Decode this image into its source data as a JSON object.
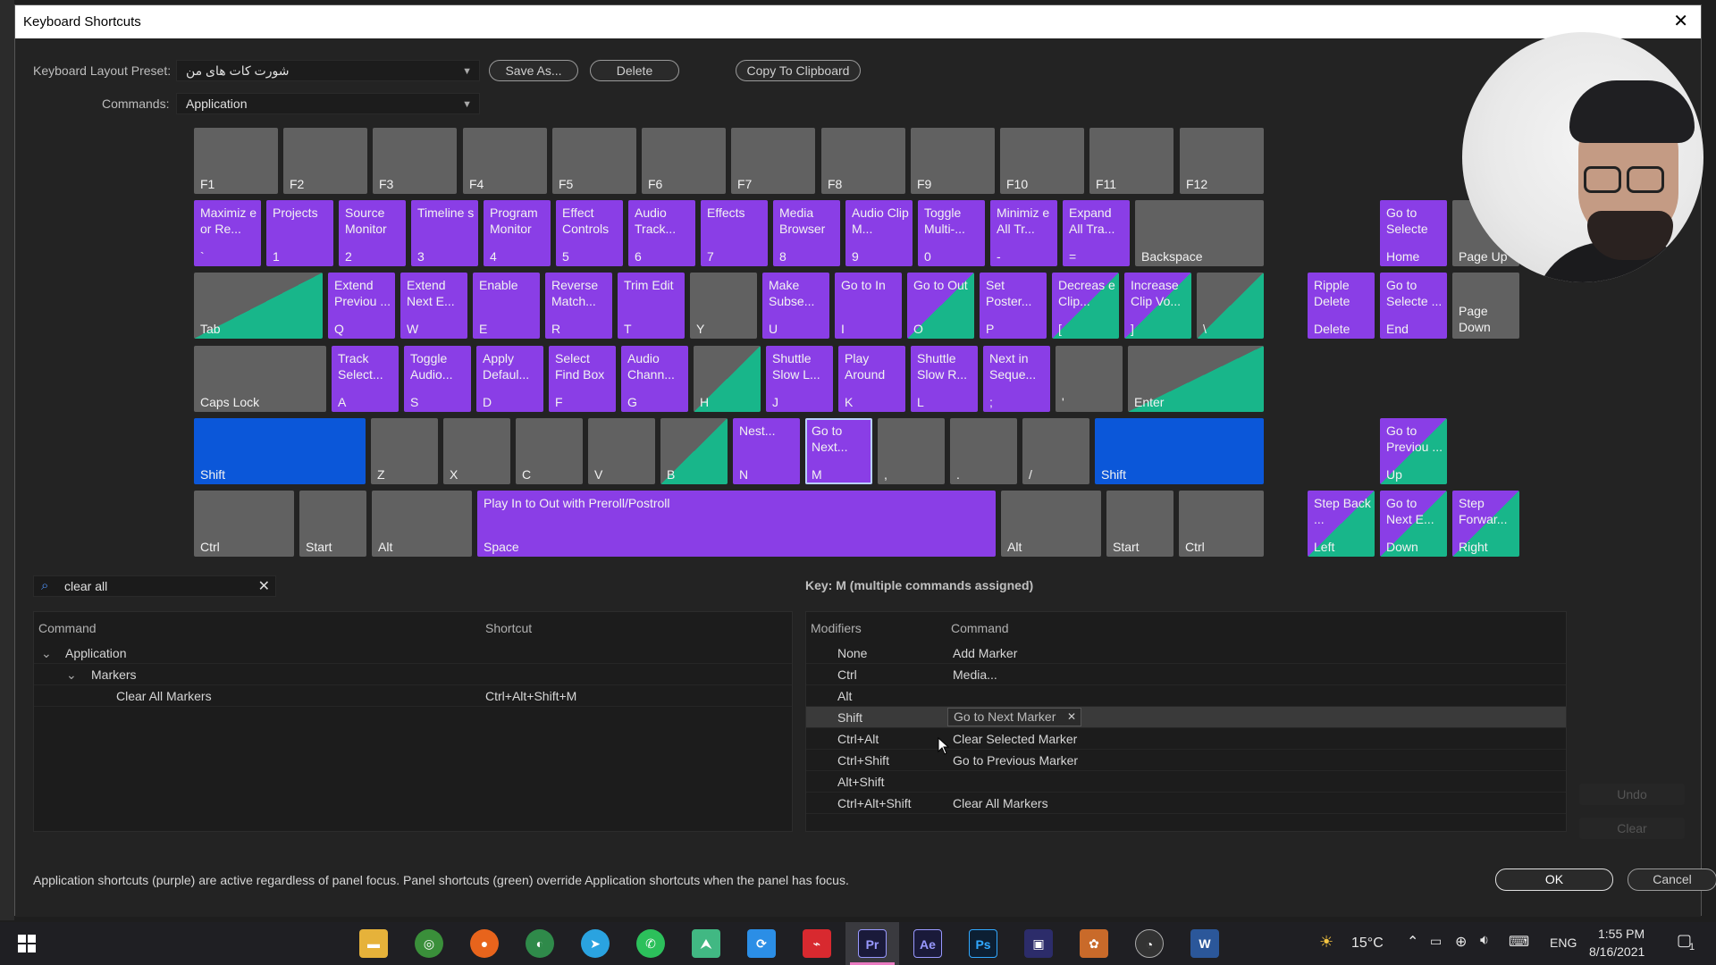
{
  "window": {
    "title": "Keyboard Shortcuts",
    "close": "✕"
  },
  "toolbar": {
    "layout_label": "Keyboard Layout Preset:",
    "layout_value": "شورت کات های من",
    "commands_label": "Commands:",
    "commands_value": "Application",
    "save_as": "Save As...",
    "delete": "Delete",
    "copy": "Copy To Clipboard"
  },
  "keys": {
    "f1": {
      "label": "F1"
    },
    "f2": {
      "label": "F2"
    },
    "f3": {
      "label": "F3"
    },
    "f4": {
      "label": "F4"
    },
    "f5": {
      "label": "F5"
    },
    "f6": {
      "label": "F6"
    },
    "f7": {
      "label": "F7"
    },
    "f8": {
      "label": "F8"
    },
    "f9": {
      "label": "F9"
    },
    "f10": {
      "label": "F10"
    },
    "f11": {
      "label": "F11"
    },
    "f12": {
      "label": "F12"
    },
    "grave": {
      "cmd": "Maximiz e or Re...",
      "label": "`"
    },
    "k1": {
      "cmd": "Projects",
      "label": "1"
    },
    "k2": {
      "cmd": "Source Monitor",
      "label": "2"
    },
    "k3": {
      "cmd": "Timeline s",
      "label": "3"
    },
    "k4": {
      "cmd": "Program Monitor",
      "label": "4"
    },
    "k5": {
      "cmd": "Effect Controls",
      "label": "5"
    },
    "k6": {
      "cmd": "Audio Track...",
      "label": "6"
    },
    "k7": {
      "cmd": "Effects",
      "label": "7"
    },
    "k8": {
      "cmd": "Media Browser",
      "label": "8"
    },
    "k9": {
      "cmd": "Audio Clip M...",
      "label": "9"
    },
    "k0": {
      "cmd": "Toggle Multi-...",
      "label": "0"
    },
    "minus": {
      "cmd": "Minimiz e All Tr...",
      "label": "-"
    },
    "equals": {
      "cmd": "Expand All Tra...",
      "label": "="
    },
    "backspace": {
      "label": "Backspace"
    },
    "tab": {
      "label": "Tab"
    },
    "q": {
      "cmd": "Extend Previou ...",
      "label": "Q"
    },
    "w": {
      "cmd": "Extend Next E...",
      "label": "W"
    },
    "e": {
      "cmd": "Enable",
      "label": "E"
    },
    "r": {
      "cmd": "Reverse Match...",
      "label": "R"
    },
    "t": {
      "cmd": "Trim Edit",
      "label": "T"
    },
    "y": {
      "label": "Y"
    },
    "u": {
      "cmd": "Make Subse...",
      "label": "U"
    },
    "i": {
      "cmd": "Go to In",
      "label": "I"
    },
    "o": {
      "cmd": "Go to Out",
      "label": "O"
    },
    "p": {
      "cmd": "Set Poster...",
      "label": "P"
    },
    "lbracket": {
      "cmd": "Decreas e Clip...",
      "label": "["
    },
    "rbracket": {
      "cmd": "Increase Clip Vo...",
      "label": "]"
    },
    "backslash": {
      "label": "\\"
    },
    "capslock": {
      "label": "Caps Lock"
    },
    "a": {
      "cmd": "Track Select...",
      "label": "A"
    },
    "s": {
      "cmd": "Toggle Audio...",
      "label": "S"
    },
    "d": {
      "cmd": "Apply Defaul...",
      "label": "D"
    },
    "f": {
      "cmd": "Select Find Box",
      "label": "F"
    },
    "g": {
      "cmd": "Audio Chann...",
      "label": "G"
    },
    "h": {
      "label": "H"
    },
    "j": {
      "cmd": "Shuttle Slow L...",
      "label": "J"
    },
    "k": {
      "cmd": "Play Around",
      "label": "K"
    },
    "l": {
      "cmd": "Shuttle Slow R...",
      "label": "L"
    },
    "semicolon": {
      "cmd": "Next in Seque...",
      "label": ";"
    },
    "quote": {
      "label": "'"
    },
    "enter": {
      "label": "Enter"
    },
    "lshift": {
      "label": "Shift"
    },
    "z": {
      "label": "Z"
    },
    "x": {
      "label": "X"
    },
    "c": {
      "label": "C"
    },
    "v": {
      "label": "V"
    },
    "b": {
      "label": "B"
    },
    "n": {
      "cmd": "Nest...",
      "label": "N"
    },
    "m": {
      "cmd": "Go to Next...",
      "label": "M"
    },
    "comma": {
      "label": ","
    },
    "period": {
      "label": "."
    },
    "slash": {
      "label": "/"
    },
    "rshift": {
      "label": "Shift"
    },
    "lctrl": {
      "label": "Ctrl"
    },
    "lstart": {
      "label": "Start"
    },
    "lalt": {
      "label": "Alt"
    },
    "space": {
      "cmd": "Play In to Out with Preroll/Postroll",
      "label": "Space"
    },
    "ralt": {
      "label": "Alt"
    },
    "rstart": {
      "label": "Start"
    },
    "rctrl": {
      "label": "Ctrl"
    },
    "home": {
      "cmd": "Go to Selecte",
      "label": "Home"
    },
    "pageup": {
      "label": "Page Up"
    },
    "delete": {
      "cmd": "Ripple Delete",
      "label": "Delete"
    },
    "end": {
      "cmd": "Go to Selecte ...",
      "label": "End"
    },
    "pagedown": {
      "label": "Page Down"
    },
    "up": {
      "cmd": "Go to Previou ...",
      "label": "Up"
    },
    "left": {
      "cmd": "Step Back ...",
      "label": "Left"
    },
    "down": {
      "cmd": "Go to Next E...",
      "label": "Down"
    },
    "right": {
      "cmd": "Step Forwar...",
      "label": "Right"
    }
  },
  "search": {
    "value": "clear all",
    "icon": "search-icon",
    "clear": "✕"
  },
  "key_info": "Key:  M (multiple commands assigned)",
  "commands_table": {
    "headers": [
      "Command",
      "Shortcut"
    ],
    "rows": [
      {
        "name": "Application",
        "shortcut": ""
      },
      {
        "name": "Markers",
        "shortcut": ""
      },
      {
        "name": "Clear All Markers",
        "shortcut": "Ctrl+Alt+Shift+M"
      }
    ]
  },
  "modifiers_table": {
    "headers": [
      "Modifiers",
      "Command"
    ],
    "rows": [
      {
        "mod": "None",
        "cmd": "Add Marker"
      },
      {
        "mod": "Ctrl",
        "cmd": "Media..."
      },
      {
        "mod": "Alt",
        "cmd": ""
      },
      {
        "mod": "Shift",
        "cmd": "Go to Next Marker"
      },
      {
        "mod": "Ctrl+Alt",
        "cmd": "Clear Selected Marker"
      },
      {
        "mod": "Ctrl+Shift",
        "cmd": "Go to Previous Marker"
      },
      {
        "mod": "Alt+Shift",
        "cmd": ""
      },
      {
        "mod": "Ctrl+Alt+Shift",
        "cmd": "Clear All Markers"
      }
    ]
  },
  "buttons": {
    "undo": "Undo",
    "clear": "Clear",
    "ok": "OK",
    "cancel": "Cancel"
  },
  "note": "Application shortcuts (purple) are active regardless of panel focus. Panel shortcuts (green) override Application shortcuts when the panel has focus.",
  "taskbar": {
    "apps": [
      "Ae",
      "Ps"
    ],
    "active_app": "Pr",
    "weather": "15°C",
    "lang": "ENG",
    "time": "1:55 PM",
    "date": "8/16/2021",
    "notifications": "1"
  },
  "colors": {
    "purple": "#8a3ee6",
    "green": "#18b68a",
    "blue": "#0b57d9",
    "gray": "#616161"
  }
}
